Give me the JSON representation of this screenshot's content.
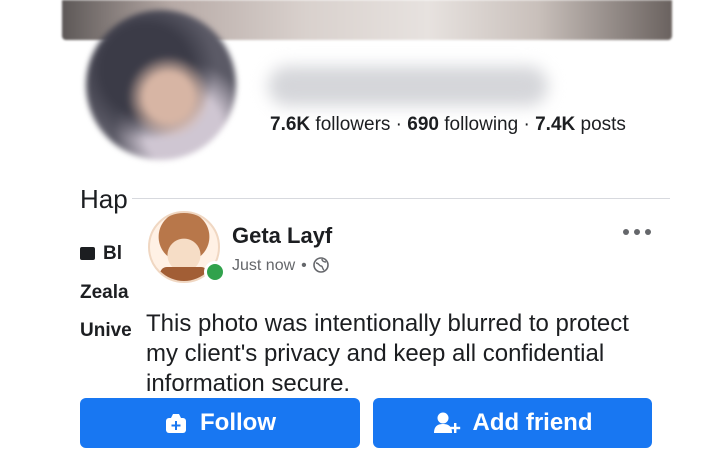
{
  "profile": {
    "stats": {
      "followers_count": "7.6K",
      "followers_label": " followers · ",
      "following_count": "690",
      "following_label": " following · ",
      "posts_count": "7.4K",
      "posts_label": " posts"
    },
    "bio_visible": "Hap",
    "info_lines": [
      "Bl",
      "Zeala",
      "Unive"
    ]
  },
  "post_overlay": {
    "author": "Geta Layf",
    "time": "Just now",
    "separator": "•",
    "text": "This photo was intentionally blurred to protect my client's privacy and keep all confidential information secure."
  },
  "actions": {
    "follow_label": "Follow",
    "add_friend_label": "Add friend"
  },
  "icons": {
    "more": "more-horizontal-icon",
    "globe": "globe-icon",
    "follow": "follow-icon",
    "add_friend": "add-friend-icon",
    "work": "briefcase-icon"
  },
  "colors": {
    "primary_button": "#1877f2",
    "online_status": "#31a24c",
    "meta_text": "#65676b"
  }
}
